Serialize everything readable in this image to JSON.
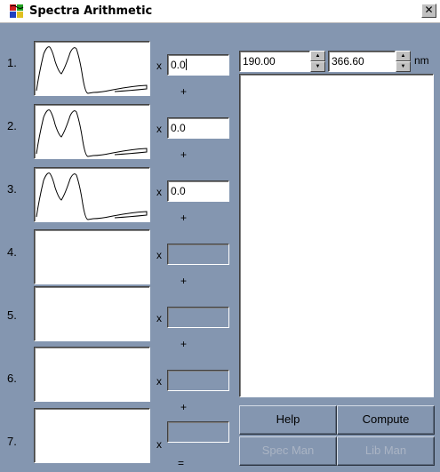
{
  "window": {
    "title": "Spectra Arithmetic",
    "close_glyph": "✕"
  },
  "rows": [
    {
      "number": "1.",
      "coefficient": "0.0",
      "enabled": true,
      "has_spectrum": true
    },
    {
      "number": "2.",
      "coefficient": "0.0",
      "enabled": true,
      "has_spectrum": true
    },
    {
      "number": "3.",
      "coefficient": "0.0",
      "enabled": true,
      "has_spectrum": true
    },
    {
      "number": "4.",
      "coefficient": "",
      "enabled": false,
      "has_spectrum": false
    },
    {
      "number": "5.",
      "coefficient": "",
      "enabled": false,
      "has_spectrum": false
    },
    {
      "number": "6.",
      "coefficient": "",
      "enabled": false,
      "has_spectrum": false
    },
    {
      "number": "7.",
      "coefficient": "",
      "enabled": false,
      "has_spectrum": false
    }
  ],
  "operators": {
    "times": "x",
    "plus": "+",
    "equals": "="
  },
  "range": {
    "start": "190.00",
    "end": "366.60",
    "unit": "nm"
  },
  "buttons": {
    "help": {
      "label": "Help",
      "enabled": true
    },
    "compute": {
      "label": "Compute",
      "enabled": true
    },
    "spec_man": {
      "label": "Spec Man",
      "enabled": false
    },
    "lib_man": {
      "label": "Lib Man",
      "enabled": false
    }
  },
  "colors": {
    "window_bg": "#8496b0",
    "field_bg": "#ffffff",
    "disabled_text": "#aab4c4"
  },
  "icons": {
    "app": "colorful-windows-flag-icon",
    "spin_up": "triangle-up",
    "spin_down": "triangle-down"
  }
}
